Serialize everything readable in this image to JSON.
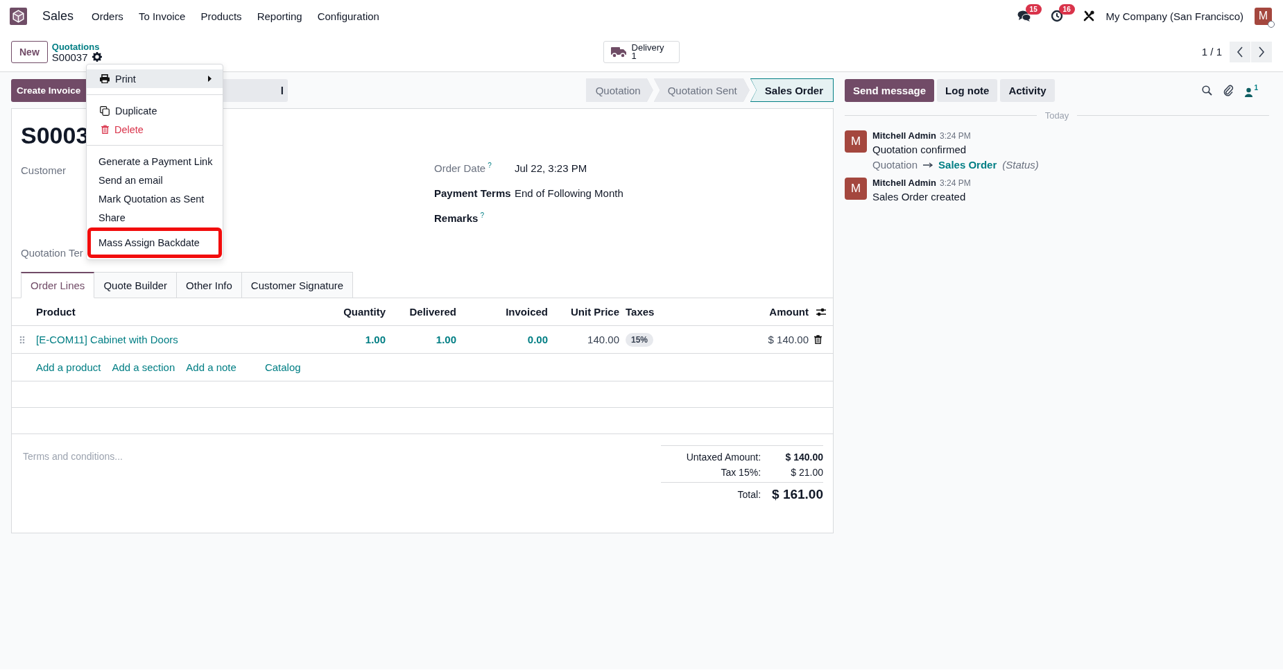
{
  "navbar": {
    "app_name": "Sales",
    "menu": [
      "Orders",
      "To Invoice",
      "Products",
      "Reporting",
      "Configuration"
    ],
    "indicators": [
      {
        "kind": "messages",
        "count": "15"
      },
      {
        "kind": "activities",
        "count": "16"
      },
      {
        "kind": "debug"
      }
    ],
    "company": "My Company (San Francisco)",
    "user_initial": "M"
  },
  "control_panel": {
    "new_button": "New",
    "breadcrumb": {
      "parent": "Quotations",
      "current": "S00037"
    },
    "smart_button": {
      "label": "Delivery",
      "count": "1"
    },
    "pager": "1 / 1"
  },
  "action_buttons": [
    {
      "label": "Create Invoice",
      "kind": "primary"
    },
    {
      "label": "l",
      "kind": "secondary"
    }
  ],
  "statusbar": [
    {
      "label": "Quotation",
      "selected": false
    },
    {
      "label": "Quotation Sent",
      "selected": false
    },
    {
      "label": "Sales Order",
      "selected": true
    }
  ],
  "action_menu": {
    "sections": [
      [
        {
          "label": "Print",
          "kind": "print",
          "hovered": true,
          "highlighted": false
        }
      ],
      [
        {
          "label": "Duplicate",
          "kind": "duplicate",
          "hovered": false,
          "highlighted": false
        },
        {
          "label": "Delete",
          "kind": "delete",
          "hovered": false,
          "highlighted": false
        }
      ],
      [
        {
          "label": "Generate a Payment Link",
          "kind": "plain",
          "hovered": false,
          "highlighted": false
        },
        {
          "label": "Send an email",
          "kind": "plain",
          "hovered": false,
          "highlighted": false
        },
        {
          "label": "Mark Quotation as Sent",
          "kind": "plain",
          "hovered": false,
          "highlighted": false
        },
        {
          "label": "Share",
          "kind": "plain",
          "hovered": false,
          "highlighted": false
        },
        {
          "label": "Mass Assign Backdate",
          "kind": "plain",
          "hovered": false,
          "highlighted": true
        }
      ]
    ]
  },
  "form": {
    "title": "S0003",
    "left_fields": [
      {
        "label": "Customer",
        "required": false
      },
      {
        "label": "Quotation Ter",
        "required": false
      }
    ],
    "right_fields": [
      {
        "label": "Order Date",
        "tooltip": "?",
        "value": "Jul 22, 3:23 PM",
        "required": false
      },
      {
        "label": "Payment Terms",
        "value": "End of Following Month",
        "required": true
      },
      {
        "label": "Remarks",
        "tooltip": "?",
        "required": true
      }
    ],
    "tabs": [
      {
        "label": "Order Lines",
        "selected": true
      },
      {
        "label": "Quote Builder",
        "selected": false
      },
      {
        "label": "Other Info",
        "selected": false
      },
      {
        "label": "Customer Signature",
        "selected": false
      }
    ],
    "table": {
      "columns": [
        "Product",
        "Quantity",
        "Delivered",
        "Invoiced",
        "Unit Price",
        "Taxes",
        "Amount"
      ],
      "rows": [
        {
          "product": "[E-COM11] Cabinet with Doors",
          "quantity": "1.00",
          "delivered": "1.00",
          "invoiced": "0.00",
          "unit_price": "140.00",
          "taxes": "15%",
          "amount": "$ 140.00"
        }
      ],
      "add_links": [
        {
          "label": "Add a product",
          "kind": "add"
        },
        {
          "label": "Add a section",
          "kind": "add"
        },
        {
          "label": "Add a note",
          "kind": "add"
        },
        {
          "label": "Catalog",
          "kind": "catalog"
        }
      ]
    },
    "terms_placeholder": "Terms and conditions...",
    "totals": [
      {
        "label": "Untaxed Amount:",
        "value": "$ 140.00",
        "kind": "untaxed"
      },
      {
        "label": "Tax 15%:",
        "value": "$ 21.00",
        "kind": "tax"
      },
      {
        "label": "Total:",
        "value": "$ 161.00",
        "kind": "total"
      }
    ]
  },
  "chatter": {
    "buttons": [
      {
        "label": "Send message",
        "kind": "primary"
      },
      {
        "label": "Log note",
        "kind": "secondary"
      },
      {
        "label": "Activity",
        "kind": "secondary"
      }
    ],
    "followers": "1",
    "separator": "Today",
    "messages": [
      {
        "avatar": "M",
        "author": "Mitchell Admin",
        "time": "3:24 PM",
        "body": "Quotation confirmed",
        "tracking": {
          "old": "Quotation",
          "new": "Sales Order",
          "field": "(Status)"
        }
      },
      {
        "avatar": "M",
        "author": "Mitchell Admin",
        "time": "3:24 PM",
        "body": "Sales Order created"
      }
    ]
  }
}
